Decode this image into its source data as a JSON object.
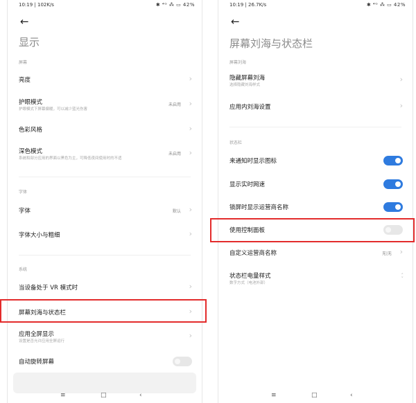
{
  "left": {
    "status": {
      "time": "10:19",
      "speed": "102K/s",
      "icons": "✱ ⁴ᴳ ⁂ ▭ 42%"
    },
    "title": "显示",
    "sections": {
      "screen": "屏幕",
      "font": "字体",
      "system": "系统"
    },
    "rows": {
      "brightness": "亮度",
      "eye_mode": "护眼模式",
      "eye_mode_sub": "护眼模式下屏幕偏暖，可以减少蓝光伤害",
      "eye_mode_value": "未启用",
      "color_style": "色彩风格",
      "dark_mode": "深色模式",
      "dark_mode_sub": "系统和部分应用的界面以黑色为主，可降低夜间使用时的不适",
      "dark_mode_value": "未启用",
      "font": "字体",
      "font_value": "默认",
      "font_size": "字体大小与粗细",
      "vr_mode": "当设备处于 VR 模式时",
      "notch_status": "屏幕刘海与状态栏",
      "fullscreen": "应用全屏显示",
      "fullscreen_sub": "设置是否允许应用全屏运行",
      "auto_rotate": "自动旋转屏幕"
    },
    "nav": {
      "menu": "≡",
      "home": "□",
      "back": "‹"
    }
  },
  "right": {
    "status": {
      "time": "10:19",
      "speed": "26.7K/s",
      "icons": "✱ ⁴ᴳ ⁂ ▭ 42%"
    },
    "title": "屏幕刘海与状态栏",
    "sections": {
      "notch": "屏幕刘海",
      "statusbar": "状态栏"
    },
    "rows": {
      "hide_notch": "隐藏屏幕刘海",
      "hide_notch_sub": "选择隐藏刘海样式",
      "app_notch": "应用内刘海设置",
      "notify_icon": "来通知时显示图标",
      "net_speed": "显示实时网速",
      "carrier_lock": "锁屏时显示运营商名称",
      "control_panel": "使用控制面板",
      "custom_carrier": "自定义运营商名称",
      "custom_carrier_value": "无|无",
      "battery_style": "状态栏电量样式",
      "battery_style_sub": "数字方式（电池外部）"
    },
    "toggles": {
      "notify_icon": true,
      "net_speed": true,
      "carrier_lock": true,
      "control_panel": false
    },
    "nav": {
      "menu": "≡",
      "home": "□",
      "back": "‹"
    }
  },
  "colors": {
    "accent": "#2f7bdf",
    "highlight": "#e32b2b"
  }
}
